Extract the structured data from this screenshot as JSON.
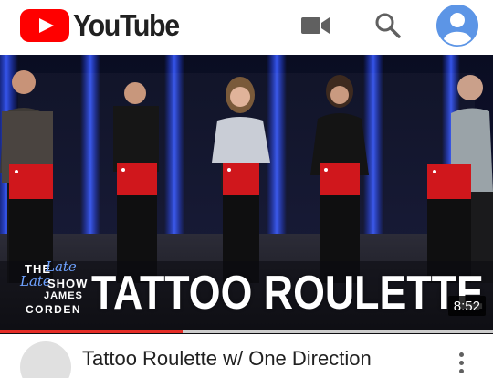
{
  "header": {
    "logo_text": "YouTube",
    "brand_color": "#ff0000",
    "icons": [
      "video-camera-icon",
      "search-icon",
      "account-avatar-icon"
    ]
  },
  "player": {
    "duration": "8:52",
    "overlay_title": "TATTOO ROULETTE",
    "show_logo": {
      "the": "THE",
      "late": "Late",
      "show": "SHOW",
      "james": "JAMES",
      "corden": "CORDEN"
    },
    "progress": 0.37,
    "progress_color": "#e52d27"
  },
  "video": {
    "title": "Tattoo Roulette w/ One Direction"
  }
}
